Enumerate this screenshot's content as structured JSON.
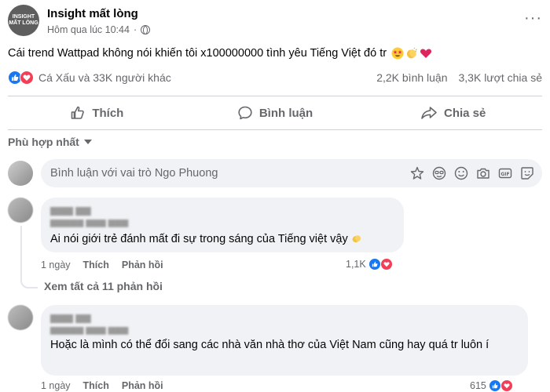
{
  "post": {
    "page_name": "Insight mất lòng",
    "avatar_text": "INSIGHT MẤT LÒNG",
    "time": "Hôm qua lúc 10:44",
    "more": "···",
    "text": "Cái trend Wattpad không nói khiến tôi x100000000 tình yêu Tiếng Việt đó tr",
    "emojis": [
      "star-struck-emoji",
      "clapping-hands-emoji",
      "red-heart-emoji"
    ]
  },
  "stats": {
    "reactions": "Cá Xấu và 33K người khác",
    "comments": "2,2K bình luận",
    "shares": "3,3K lượt chia sẻ"
  },
  "actions": {
    "like": "Thích",
    "comment": "Bình luận",
    "share": "Chia sẻ"
  },
  "sort": {
    "label": "Phù hợp nhất"
  },
  "composer": {
    "placeholder": "Bình luận với vai trò Ngo Phuong"
  },
  "comments": [
    {
      "text": "Ai nói giới trẻ đánh mất đi sự trong sáng của Tiếng việt vậy",
      "time": "1 ngày",
      "like": "Thích",
      "reply": "Phản hồi",
      "reactions": "1,1K",
      "view_replies": "Xem tất cả 11 phản hồi"
    },
    {
      "text": "Hoặc là mình có thể đổi sang các nhà văn nhà thơ của Việt Nam cũng hay quá tr luôn í",
      "time": "1 ngày",
      "like": "Thích",
      "reply": "Phản hồi",
      "reactions": "615"
    }
  ],
  "colors": {
    "like_blue": "#1877f2",
    "love_red": "#f33e58",
    "secondary_text": "#65676b",
    "bubble_bg": "#f0f2f5"
  }
}
